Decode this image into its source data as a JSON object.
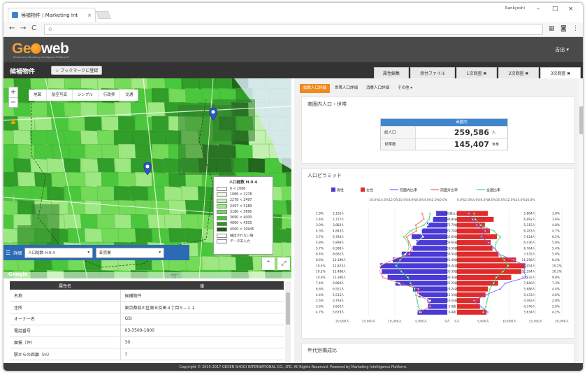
{
  "browser": {
    "tab_title": "候補物件 | Marketing Int",
    "tab_close": "×",
    "window_user": "Rankyoshi",
    "win_min": "–",
    "win_max": "□",
    "win_close": "×",
    "back": "←",
    "forward": "→",
    "reload": "C",
    "url_icon": "⊙"
  },
  "app": {
    "logo_ge": "Ge",
    "logo_rest": "web",
    "tagline": "Powered by Marketing Intelligence Platform®",
    "user_menu": "吉出 ▾",
    "page_title": "候補物件",
    "bookmark_button": "☆ ブックマークに登録",
    "right_tabs": [
      "属性編集",
      "添付ファイル",
      "1次商圏 ✖",
      "2次商圏 ✖",
      "3次商圏 ✖"
    ]
  },
  "map": {
    "zoom_in": "+",
    "zoom_out": "−",
    "map_types": [
      "地図",
      "航空写真",
      "シンプル",
      "行政界",
      "交通"
    ],
    "legend_title": "人口総数 H.0.4",
    "legend": [
      {
        "label": "0 < 1086",
        "color": "#ffffff"
      },
      {
        "label": "1086 < 2278",
        "color": "#e8f9e0"
      },
      {
        "label": "2278 < 2497",
        "color": "#c5f3b4"
      },
      {
        "label": "2497 < 3180",
        "color": "#9cea80"
      },
      {
        "label": "3180 < 3690",
        "color": "#6fdc55"
      },
      {
        "label": "3690 < 4000",
        "color": "#42c635"
      },
      {
        "label": "4000 < 4500",
        "color": "#279a22"
      },
      {
        "label": "4500 < 10945",
        "color": "#165f14"
      },
      {
        "label": "抽出されない値",
        "color": "#ffffff"
      },
      {
        "label": "データ未入力",
        "color": "#ffffff"
      }
    ],
    "detail_label": "詳細",
    "select1": "人口総数 H.0.4",
    "select2": "卸売業",
    "google": "Google",
    "map_footer": "地図データ ©2017 Google, ZENRIN  利用規約  地図の誤りを報告する"
  },
  "table": {
    "headers": [
      "属性名",
      "値"
    ],
    "rows": [
      [
        "名称",
        "候補物件"
      ],
      [
        "住所",
        "東京都品川区東五反田４丁目５−１１"
      ],
      [
        "オーナー名",
        "GSI"
      ],
      [
        "電話番号",
        "03-3509-1800"
      ],
      [
        "面積（坪）",
        "30"
      ],
      [
        "駅からの距離（m）",
        "1"
      ]
    ]
  },
  "right": {
    "tabs": [
      "総数人口詳細",
      "世帯人口詳細",
      "消費人口詳細",
      "その他 ▾"
    ],
    "card1_title": "商圏内人口・世帯",
    "summary_head": "商圏内",
    "summary": [
      {
        "label": "総人口",
        "value": "259,586",
        "unit": "人"
      },
      {
        "label": "世帯数",
        "value": "145,407",
        "unit": "世帯"
      }
    ],
    "card2_title": "人口ピラミッド",
    "card3_title": "年代別構成比"
  },
  "chart_data": {
    "type": "bar",
    "legend": [
      "男性",
      "女性",
      "商圏内比率",
      "商圏外比率",
      "全国比率"
    ],
    "colors": {
      "male": "#4a3ad6",
      "female": "#e02b2b",
      "area": "#7a5cff",
      "outside": "#ff5a5a",
      "national": "#3fd675"
    },
    "categories": [
      "85歳以上",
      "80-84歳",
      "75-79歳",
      "70-74歳",
      "65-69歳",
      "60-64歳",
      "55-59歳",
      "50-54歳",
      "45-49歳",
      "40-44歳",
      "35-39歳",
      "30-34歳",
      "25-29歳",
      "20-24歳",
      "15-19歳",
      "10-14歳",
      "5-9歳",
      "0-4歳"
    ],
    "male": [
      2132,
      2717,
      3883,
      4843,
      6783,
      5898,
      6588,
      8682,
      10389,
      12823,
      12488,
      11380,
      9880,
      6551,
      5515,
      3793,
      3662,
      5679
    ],
    "female": [
      5884,
      6992,
      5315,
      6283,
      7624,
      6436,
      6764,
      7935,
      11258,
      13054,
      12294,
      10332,
      7840,
      5888,
      5433,
      4383,
      4376,
      5634
    ],
    "male_labels": [
      "2,132人",
      "2,717人",
      "3,883人",
      "4,843人",
      "6,783人",
      "5,898人",
      "6,588人",
      "8,682人",
      "10,389人",
      "12,823人",
      "12,488人",
      "11,380人",
      "9,880人",
      "6,551人",
      "5,515人",
      "3,793人",
      "3,662人",
      "5,679人"
    ],
    "female_labels": [
      "5,884人",
      "6,992人",
      "5,315人",
      "6,283人",
      "7,624人",
      "6,436人",
      "6,764人",
      "7,935人",
      "11,258人",
      "13,054人",
      "12,294人",
      "10,332人",
      "7,840人",
      "5,888人",
      "5,433人",
      "4,383人",
      "4,376人",
      "5,634人"
    ],
    "male_pct": [
      "1.8%",
      "2.4%",
      "3.0%",
      "4.3%",
      "3.7%",
      "4.8%",
      "5.7%",
      "6.4%",
      "8.6%",
      "10.4%",
      "10.2%",
      "10.6%",
      "7.4%",
      "6.6%",
      "4.4%",
      "2.6%",
      "3.6%",
      "4.7%"
    ],
    "female_pct": [
      "3.8%",
      "3.6%",
      "4.8%",
      "4.7%",
      "6.2%",
      "5.8%",
      "5.4%",
      "5.8%",
      "8.4%",
      "10.2%",
      "10.3%",
      "9.8%",
      "7.3%",
      "4.4%",
      "4.6%",
      "2.8%",
      "2.6%",
      "4.2%"
    ],
    "area_ratio": [
      1.8,
      2.4,
      3.0,
      4.3,
      3.7,
      4.8,
      5.7,
      6.4,
      8.6,
      10.4,
      10.2,
      10.6,
      7.4,
      6.6,
      4.4,
      2.6,
      3.6,
      4.7
    ],
    "outside_ratio": [
      3.8,
      3.6,
      4.8,
      4.7,
      6.2,
      5.8,
      5.4,
      5.8,
      8.4,
      10.2,
      10.3,
      9.8,
      7.3,
      4.4,
      4.6,
      2.8,
      2.6,
      4.2
    ],
    "national_ratio": [
      2.6,
      2.8,
      3.6,
      5.6,
      6.6,
      6.0,
      5.8,
      6.4,
      7.2,
      7.8,
      7.0,
      6.0,
      5.6,
      5.0,
      4.8,
      4.6,
      4.4,
      4.0
    ],
    "top_axis": "16.0%14.0%12.0%10.0%8.0%6.0%4.0%2.0%0.0%",
    "top_axis_right": "0.0%2.0%4.0%6.0%8.0%10.0%12.0%14.0%16.0%",
    "bottom_left_ticks": [
      "20,000人",
      "15,000人",
      "10,000人",
      "5,000人",
      "0人"
    ],
    "bottom_right_ticks": [
      "0人",
      "5,000人",
      "10,000人",
      "15,000人",
      "20,000人"
    ],
    "xlim": [
      0,
      20000
    ]
  },
  "footer": "Copyright © 2015-2017 GEXEN SHOGI INTERNATIONAL CO., LTD. All Rights Reserved.  Powered by Marketing Intelligence Platform."
}
